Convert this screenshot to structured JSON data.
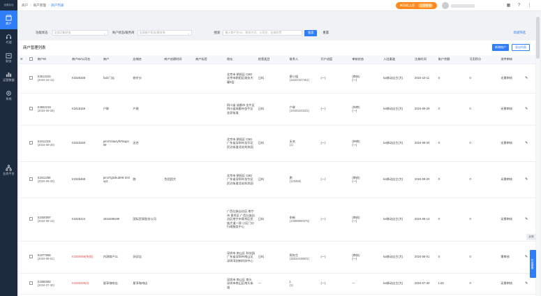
{
  "nav": {
    "brand": "运营后台",
    "items": [
      {
        "label": "商户",
        "icon": "store-icon",
        "active": true
      },
      {
        "label": "代理",
        "icon": "headset-icon",
        "active": false
      },
      {
        "label": "财务",
        "icon": "finance-icon",
        "active": false
      },
      {
        "label": "运营数据",
        "icon": "chart-icon",
        "active": false
      },
      {
        "label": "系统",
        "icon": "gear-icon",
        "active": false
      }
    ],
    "bottom": {
      "label": "业态平台",
      "icon": "network-icon"
    }
  },
  "topbar": {
    "breadcrumb": [
      "商户",
      "商户管理",
      "商户列表"
    ],
    "promo_text": "新功能上线",
    "promo_action": "立即查看",
    "icons": [
      "grid-icon",
      "help-icon",
      "more-icon"
    ]
  },
  "filter": {
    "label1": "功能状态",
    "select1_placeholder": "全部功能状态",
    "label2": "商户状态/服务商",
    "select2_placeholder": "全部商户状态/服务商",
    "label3": "搜索",
    "search_placeholder": "输入商户名/ID、联系方式、公司名、店铺名等",
    "search_button": "搜索",
    "reset_link": "重置",
    "advanced_link": "高级筛选"
  },
  "card": {
    "title": "商户管理列表",
    "add_button": "新增商户",
    "export_button": "导出列表"
  },
  "table": {
    "columns": [
      "商户ID",
      "商户ID/公司名",
      "商户",
      "店铺名",
      "商户创建时间",
      "商户标签",
      "地址",
      "经营类目",
      "联系人",
      "开户进度",
      "审核状态",
      "入驻渠道",
      "注册时间",
      "账户余额",
      "可用积分",
      "进件审核",
      "操作"
    ],
    "rows": [
      {
        "id": "S3513154",
        "date": "(2024-10-11)",
        "cid": "K3325328",
        "merchant": "fxdz门店",
        "shop": "修步分",
        "addr": "北京市 朝阳区 CBD 北京市朝阳区商务大厦8层",
        "category": "日料",
        "contact": "廖小姐",
        "phone": "(18167227451)",
        "progress": "(—)",
        "review": "(审核)",
        "review2": "(—)",
        "channel": "ka移动自主(大)",
        "reg": "2024-10-11",
        "balance": "0",
        "points": "0",
        "status": "无需审核"
      },
      {
        "id": "S3662219",
        "date": "(2024-09-29)",
        "cid": "K3418159",
        "merchant": "户联",
        "shop": "户联",
        "addr": "四川省 成都市 金牛区 四川省成都市金牛区金泉街道",
        "category": "日料",
        "contact": "户联",
        "phone": "(18184243231)",
        "progress": "(—)",
        "review": "(待审)",
        "review2": "(—)",
        "channel": "ka移动自主(大)",
        "reg": "2024-09-29",
        "balance": "0",
        "points": "0",
        "status": "无需审核"
      },
      {
        "id": "S3411318",
        "date": "(2024-09-20)",
        "cid": "K3315340",
        "merchant": "pm47d4azyf678ap309",
        "shop": "无名",
        "addr": "北京市 朝阳区 CBD 广东省深圳市龙华区民治街道北站科技园",
        "category": "日料",
        "contact": "无名",
        "phone": "(1)",
        "progress": "(—)",
        "review": "(待审)",
        "review2": "(—)",
        "channel": "ka移动自主(大)",
        "reg": "2024-09-20",
        "balance": "0",
        "points": "0",
        "status": "无需审核"
      },
      {
        "id": "S3411258",
        "date": "(2024-09-20)",
        "cid": "K3325468",
        "merchant": "pm4Tg3xkubH6-2n0xy3",
        "shop": "跑",
        "tag": "色团团大",
        "addr": "北京市 朝阳区 CBD 广东省深圳市龙华区民治街道北站科技园",
        "category": "日料",
        "contact": "跑",
        "phone": "(123456)",
        "progress": "(—)",
        "review": "(审核)",
        "review2": "(—)",
        "channel": "ka移动自主(大)",
        "reg": "2024-09-20",
        "balance": "0",
        "points": "0",
        "status": "无需审核"
      },
      {
        "id": "S2400097",
        "date": "(2024-08-13)",
        "cid": "K3325224",
        "merchant": "1834289190",
        "shop": "国际贸易股份公司",
        "addr": "广西壮族自治区 南宁市 青秀区 广西壮族自治区南宁市青秀区民族大道一段 小区门口 行政服务中心",
        "category": "日料",
        "contact": "申新",
        "phone": "(13068900375)",
        "progress": "(—)",
        "review": "(审核)",
        "review2": "(—)",
        "channel": "ka移动自主(大)",
        "reg": "2024-08-13",
        "balance": "0",
        "points": "0",
        "status": "无需审核"
      },
      {
        "id": "S2377656",
        "date": "(2024-08-01)",
        "cid": "K3300069(失效)",
        "merchant": "内测商户11",
        "shop": "测试店",
        "addr": "深圳市 南山区 科技园 广东省深圳市南山区深圳湾创新科技中心",
        "category": "日料",
        "contact": "周先生",
        "phone": "(15034438831)",
        "progress": "(—)",
        "review": "(审核)",
        "review2": "(—)",
        "channel": "ka移动自主(大)",
        "reg": "2024-08-01",
        "balance": "0",
        "points": "0",
        "status": "需审核"
      },
      {
        "id": "S3366382",
        "date": "(2024-07-30)",
        "cid": "K3283225(2)",
        "merchant": "星享咖啡店",
        "shop": "星享咖啡店",
        "addr": "深圳市 南山区 南头 深圳市南山区南头街道",
        "category": "—",
        "contact": "1",
        "phone": "(1)",
        "progress": "(—)",
        "review": "—",
        "review2": "",
        "channel": "ka移动自主(大)",
        "reg": "2024-07-30",
        "balance": "1.82",
        "points": "0",
        "status": "无需审核"
      }
    ]
  },
  "float": {
    "feedback": "反馈",
    "service": "在线客服"
  }
}
